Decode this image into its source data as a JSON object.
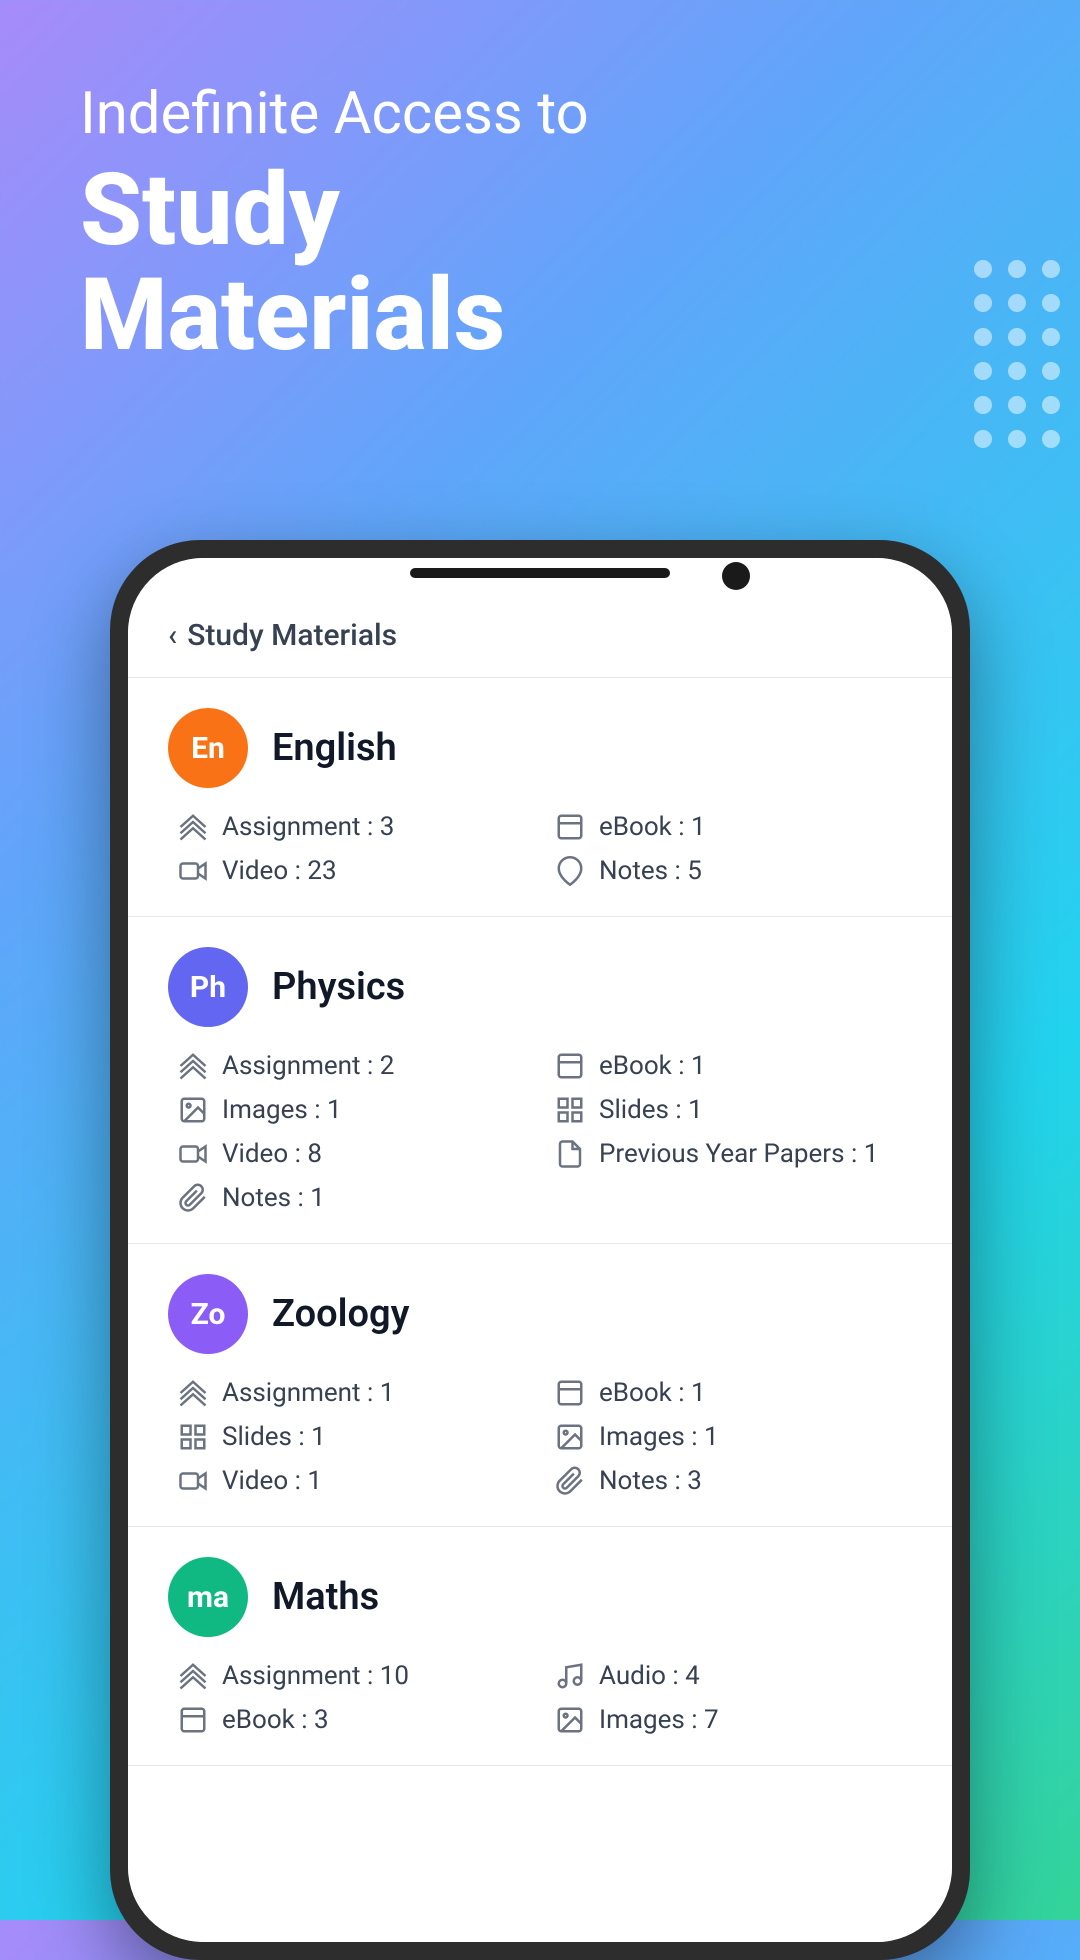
{
  "hero": {
    "tagline": "Indefinite Access to",
    "title_line1": "Study",
    "title_line2": "Materials"
  },
  "screen": {
    "back_label": "Study Materials",
    "subjects": [
      {
        "id": "english",
        "name": "English",
        "avatar_text": "En",
        "avatar_class": "avatar-english",
        "stats": [
          {
            "icon": "layers",
            "label": "Assignment : 3"
          },
          {
            "icon": "book",
            "label": "eBook : 1"
          },
          {
            "icon": "video",
            "label": "Video : 23"
          },
          {
            "icon": "clip",
            "label": "Notes : 5"
          }
        ]
      },
      {
        "id": "physics",
        "name": "Physics",
        "avatar_text": "Ph",
        "avatar_class": "avatar-physics",
        "stats": [
          {
            "icon": "layers",
            "label": "Assignment : 2"
          },
          {
            "icon": "book",
            "label": "eBook : 1"
          },
          {
            "icon": "image",
            "label": "Images : 1"
          },
          {
            "icon": "grid",
            "label": "Slides : 1"
          },
          {
            "icon": "video",
            "label": "Video : 8"
          },
          {
            "icon": "doc",
            "label": "Previous Year Papers : 1"
          },
          {
            "icon": "clip",
            "label": "Notes : 1"
          }
        ]
      },
      {
        "id": "zoology",
        "name": "Zoology",
        "avatar_text": "Zo",
        "avatar_class": "avatar-zoology",
        "stats": [
          {
            "icon": "layers",
            "label": "Assignment : 1"
          },
          {
            "icon": "book",
            "label": "eBook : 1"
          },
          {
            "icon": "grid",
            "label": "Slides : 1"
          },
          {
            "icon": "image",
            "label": "Images : 1"
          },
          {
            "icon": "video",
            "label": "Video : 1"
          },
          {
            "icon": "clip",
            "label": "Notes : 3"
          }
        ]
      },
      {
        "id": "maths",
        "name": "Maths",
        "avatar_text": "ma",
        "avatar_class": "avatar-maths",
        "stats": [
          {
            "icon": "layers",
            "label": "Assignment : 10"
          },
          {
            "icon": "audio",
            "label": "Audio : 4"
          },
          {
            "icon": "book",
            "label": "eBook : 3"
          },
          {
            "icon": "image",
            "label": "Images : 7"
          }
        ]
      }
    ]
  }
}
